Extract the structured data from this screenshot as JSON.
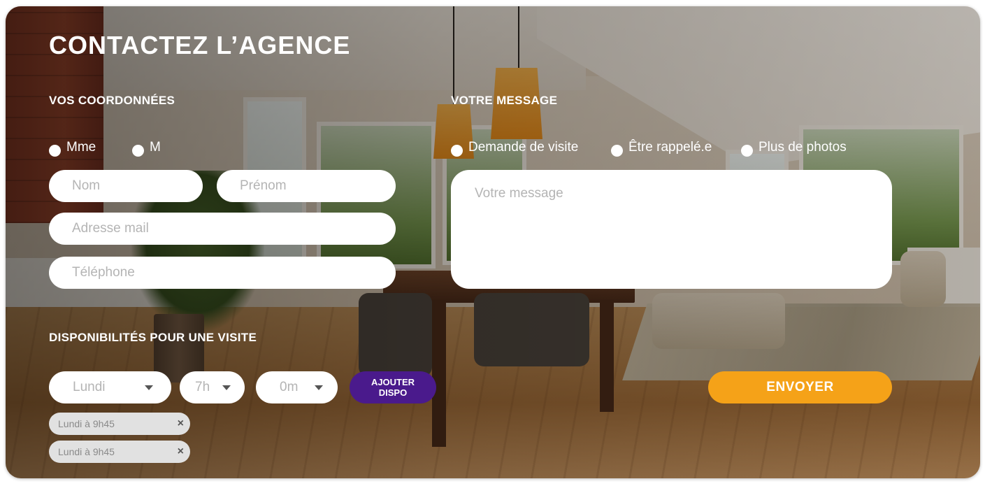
{
  "title": "CONTACTEZ L’AGENCE",
  "coords": {
    "heading": "VOS COORDONNÉES",
    "civility": [
      {
        "label": "Mme"
      },
      {
        "label": "M"
      }
    ],
    "placeholders": {
      "nom": "Nom",
      "prenom": "Prénom",
      "email": "Adresse mail",
      "phone": "Téléphone"
    }
  },
  "message": {
    "heading": "VOTRE MESSAGE",
    "options": [
      {
        "label": "Demande de visite"
      },
      {
        "label": "Être rappelé.e"
      },
      {
        "label": "Plus de photos"
      }
    ],
    "placeholder": "Votre message"
  },
  "dispo": {
    "heading": "DISPONIBILITÉS POUR UNE VISITE",
    "day": "Lundi",
    "hour": "7h",
    "minute": "0m",
    "add_label_line1": "AJOUTER",
    "add_label_line2": "DISPO",
    "chips": [
      {
        "label": "Lundi à 9h45"
      },
      {
        "label": "Lundi à 9h45"
      }
    ],
    "remove_icon": "×"
  },
  "send_label": "ENVOYER",
  "colors": {
    "accent_orange": "#f5a218",
    "accent_purple": "#4a1a8c"
  }
}
